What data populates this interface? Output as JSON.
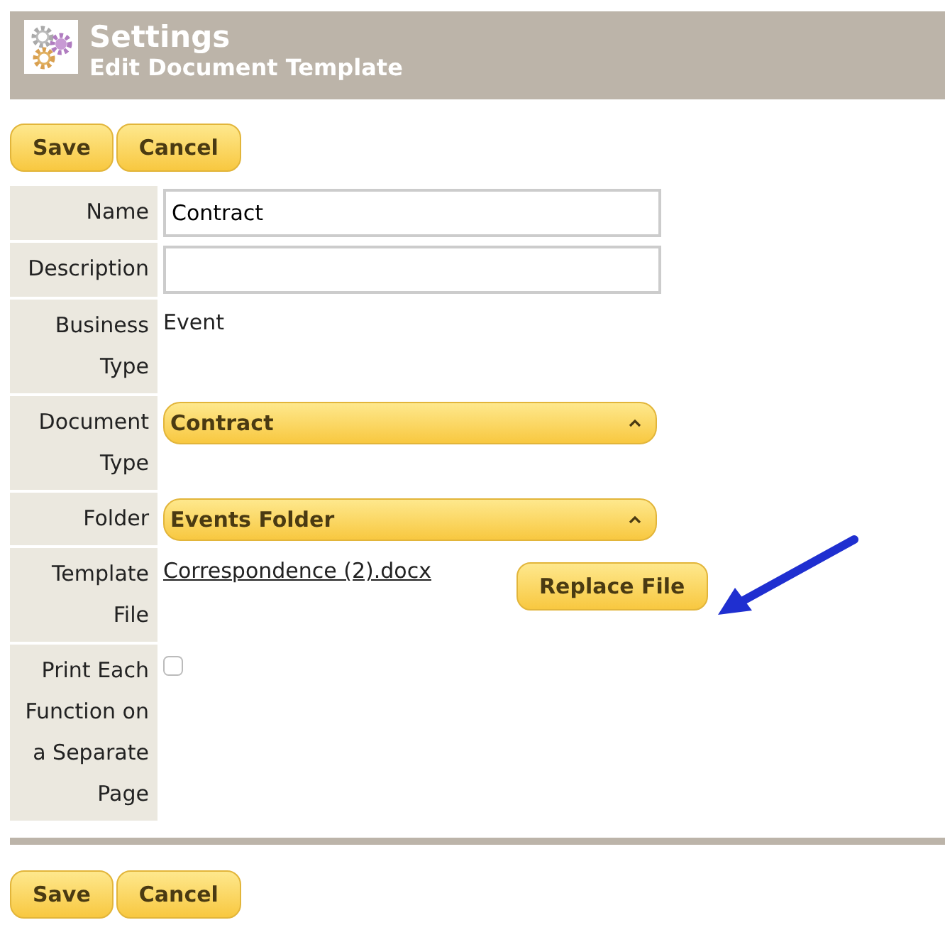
{
  "header": {
    "title": "Settings",
    "subtitle": "Edit Document Template"
  },
  "top_buttons": [
    "Save",
    "Cancel"
  ],
  "fields": [
    {
      "label": "Name",
      "kind": "text",
      "value": "Contract"
    },
    {
      "label": "Description",
      "kind": "text"
    },
    {
      "label": "Business Type",
      "kind": "static",
      "value": "Event"
    },
    {
      "label": "Document Type",
      "kind": "select",
      "value": "Contract"
    },
    {
      "label": "Folder",
      "kind": "select",
      "value": "Events Folder"
    },
    {
      "label": "Template File",
      "kind": "file",
      "value": "Correspondence (2).docx",
      "button": "Replace File"
    },
    {
      "label": "Print Each Function on a Separate Page",
      "kind": "checkbox",
      "checked": false
    }
  ],
  "bottom_buttons": [
    "Save",
    "Cancel"
  ]
}
